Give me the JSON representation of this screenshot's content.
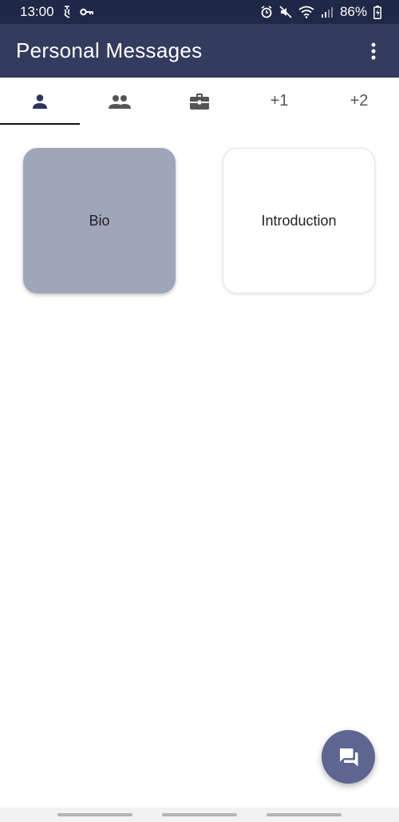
{
  "status_bar": {
    "time": "13:00",
    "battery": "86%",
    "icons_left": [
      "notification-icon",
      "key-icon"
    ],
    "icons_right": [
      "alarm-icon",
      "mute-icon",
      "wifi-icon",
      "signal-icon",
      "battery-icon"
    ]
  },
  "app_bar": {
    "title": "Personal Messages",
    "overflow_icon": "more-vert-icon"
  },
  "tabs": [
    {
      "icon": "person-icon",
      "label": "",
      "active": true
    },
    {
      "icon": "people-icon",
      "label": "",
      "active": false
    },
    {
      "icon": "briefcase-icon",
      "label": "",
      "active": false
    },
    {
      "icon": "",
      "label": "+1",
      "active": false
    },
    {
      "icon": "",
      "label": "+2",
      "active": false
    }
  ],
  "cards": [
    {
      "label": "Bio",
      "selected": true
    },
    {
      "label": "Introduction",
      "selected": false
    }
  ],
  "fab": {
    "icon": "chat-icon"
  },
  "colors": {
    "status_bar": "#1f2846",
    "app_bar": "#333b5e",
    "selected_card": "#9fa6ba",
    "fab": "#5e6591"
  }
}
